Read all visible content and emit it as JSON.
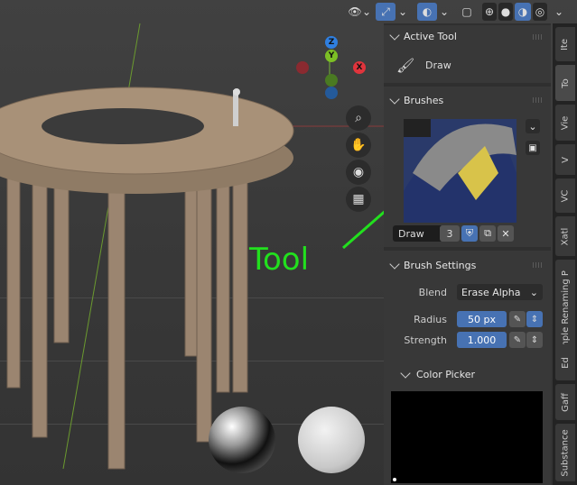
{
  "header": {
    "icons": [
      "eye-icon",
      "chevron-down-icon",
      "gizmo-icon",
      "chevron-down-icon",
      "overlay-icon",
      "chevron-down-icon",
      "xray-icon",
      "wireframe-icon",
      "solid-icon",
      "material-icon",
      "rendered-icon",
      "chevron-down-icon"
    ]
  },
  "gizmo": {
    "z": "Z",
    "y": "Y",
    "x": "X"
  },
  "annotation": {
    "text": "Tool"
  },
  "active_tool": {
    "title": "Active Tool",
    "tool_name": "Draw"
  },
  "brushes": {
    "title": "Brushes",
    "name": "Draw",
    "users": "3"
  },
  "brush_settings": {
    "title": "Brush Settings",
    "blend_label": "Blend",
    "blend_value": "Erase Alpha",
    "radius_label": "Radius",
    "radius_value": "50 px",
    "strength_label": "Strength",
    "strength_value": "1.000"
  },
  "color_picker": {
    "title": "Color Picker"
  },
  "tabs": [
    "Ite",
    "To",
    "Vie",
    "V",
    "VC",
    "Xatl",
    "Simple Renaming P",
    "Ed",
    "Gaff",
    "Substance"
  ],
  "colors": {
    "accent": "#4772b3",
    "annotation": "#22e01e"
  }
}
